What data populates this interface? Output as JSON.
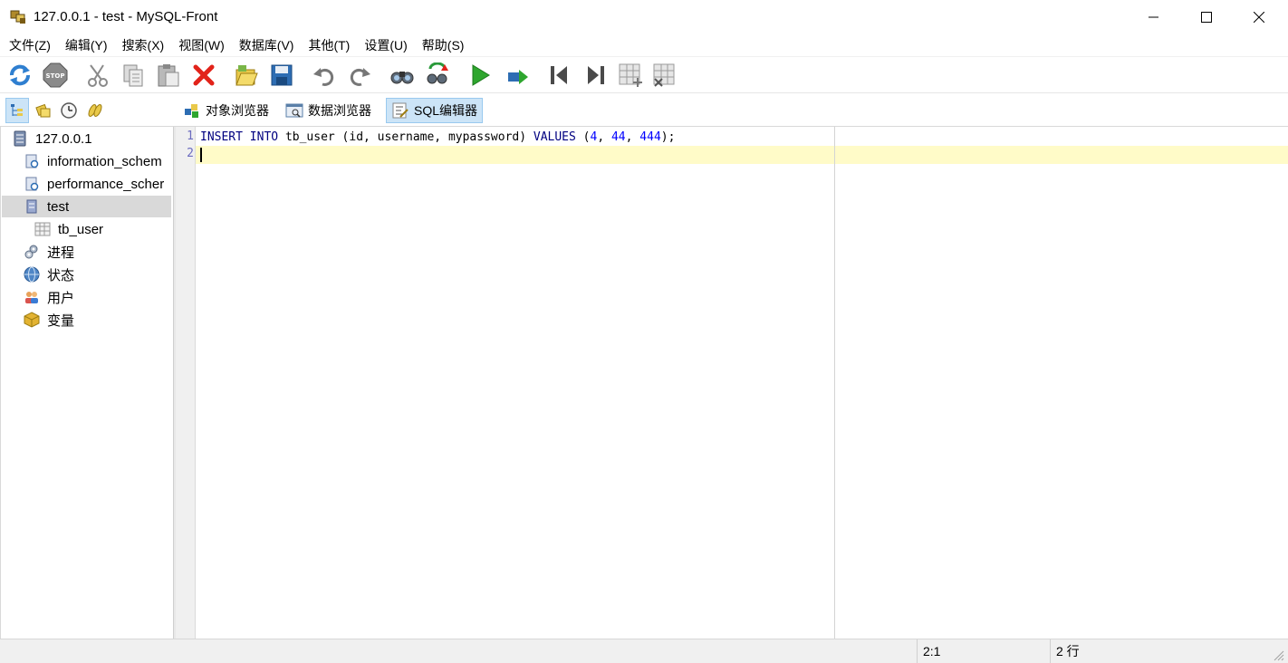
{
  "window": {
    "title": "127.0.0.1 - test - MySQL-Front"
  },
  "menu": [
    {
      "label": "文件(Z)"
    },
    {
      "label": "编辑(Y)"
    },
    {
      "label": "搜索(X)"
    },
    {
      "label": "视图(W)"
    },
    {
      "label": "数据库(V)"
    },
    {
      "label": "其他(T)"
    },
    {
      "label": "设置(U)"
    },
    {
      "label": "帮助(S)"
    }
  ],
  "toolbar": [
    {
      "icon": "refresh-icon"
    },
    {
      "icon": "stop-icon",
      "text": "STOP"
    },
    {
      "icon": "cut-icon"
    },
    {
      "icon": "copy-icon"
    },
    {
      "icon": "paste-icon"
    },
    {
      "icon": "delete-icon"
    },
    {
      "icon": "open-folder-icon"
    },
    {
      "icon": "save-icon"
    },
    {
      "icon": "undo-icon"
    },
    {
      "icon": "redo-icon"
    },
    {
      "icon": "find-icon"
    },
    {
      "icon": "replace-icon"
    },
    {
      "icon": "run-icon"
    },
    {
      "icon": "run-selection-icon"
    },
    {
      "icon": "first-icon"
    },
    {
      "icon": "last-icon"
    },
    {
      "icon": "insert-record-icon"
    },
    {
      "icon": "delete-record-icon"
    }
  ],
  "navigator_buttons": [
    {
      "icon": "tree-icon",
      "active": true
    },
    {
      "icon": "bookmarks-icon",
      "active": false
    },
    {
      "icon": "history-icon",
      "active": false
    },
    {
      "icon": "sql-files-icon",
      "active": false
    }
  ],
  "view_tabs": [
    {
      "label": "对象浏览器",
      "icon": "object-browser-icon",
      "active": false
    },
    {
      "label": "数据浏览器",
      "icon": "data-browser-icon",
      "active": false
    },
    {
      "label": "SQL编辑器",
      "icon": "sql-editor-icon",
      "active": true
    }
  ],
  "tree": {
    "root": {
      "label": "127.0.0.1",
      "icon": "server-icon"
    },
    "databases": [
      {
        "label": "information_schem",
        "icon": "system-database-icon",
        "selected": false
      },
      {
        "label": "performance_scher",
        "icon": "system-database-icon",
        "selected": false
      },
      {
        "label": "test",
        "icon": "database-icon",
        "selected": true
      }
    ],
    "tables": [
      {
        "label": "tb_user",
        "icon": "table-icon"
      }
    ],
    "others": [
      {
        "label": "进程",
        "icon": "processes-icon"
      },
      {
        "label": "状态",
        "icon": "status-icon"
      },
      {
        "label": "用户",
        "icon": "users-icon"
      },
      {
        "label": "变量",
        "icon": "variables-icon"
      }
    ]
  },
  "editor": {
    "line_numbers": [
      "1",
      "2"
    ],
    "line1": {
      "kw1": "INSERT",
      "kw2": "INTO",
      "t1": "tb_user (id, username, mypassword)",
      "kw3": "VALUES",
      "p1": "(",
      "n1": "4",
      "c1": ",",
      "n2": "44",
      "c2": ",",
      "n3": "444",
      "p2": ");"
    },
    "current_line_color": "#fffbc8",
    "keyword_color": "#000080",
    "number_color": "#0000ff"
  },
  "status": {
    "position": "2:1",
    "lines": "2 行"
  }
}
